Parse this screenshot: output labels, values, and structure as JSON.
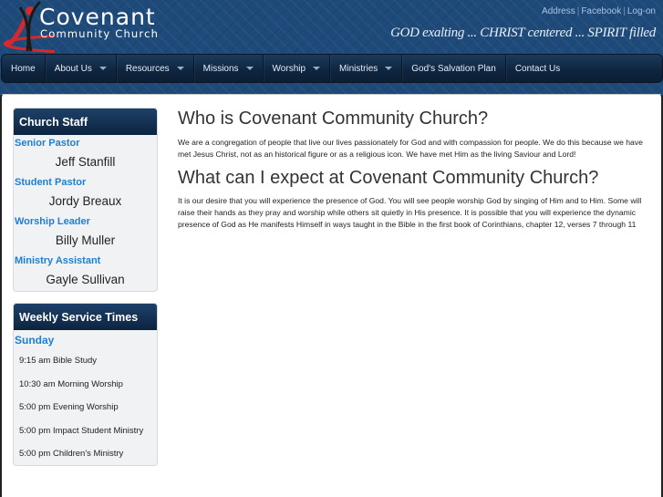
{
  "header": {
    "logo_title": "Covenant",
    "logo_subtitle": "Community Church",
    "logo_colors": {
      "accent_red": "#d42a2f",
      "dark": "#1a1a1a"
    },
    "top_links": [
      "Address",
      "Facebook",
      "Log-on"
    ],
    "tagline": "GOD exalting ... CHRIST centered ... SPIRIT filled"
  },
  "nav": {
    "items": [
      {
        "label": "Home",
        "dropdown": false
      },
      {
        "label": "About Us",
        "dropdown": true
      },
      {
        "label": "Resources",
        "dropdown": true
      },
      {
        "label": "Missions",
        "dropdown": true
      },
      {
        "label": "Worship",
        "dropdown": true
      },
      {
        "label": "Ministries",
        "dropdown": true
      },
      {
        "label": "God's Salvation Plan",
        "dropdown": false
      },
      {
        "label": "Contact Us",
        "dropdown": false
      }
    ]
  },
  "sidebar": {
    "staff": {
      "title": "Church Staff",
      "members": [
        {
          "role": "Senior Pastor",
          "name": "Jeff Stanfill"
        },
        {
          "role": "Student Pastor",
          "name": "Jordy Breaux"
        },
        {
          "role": "Worship Leader",
          "name": "Billy Muller"
        },
        {
          "role": "Ministry Assistant",
          "name": "Gayle Sullivan"
        }
      ]
    },
    "services": {
      "title": "Weekly Service Times",
      "day": "Sunday",
      "items": [
        "9:15 am Bible Study",
        "10:30 am Morning Worship",
        "5:00 pm Evening Worship",
        "5:00 pm Impact Student Ministry",
        "5:00 pm Children's Ministry"
      ]
    }
  },
  "main": {
    "heading1": "Who is Covenant Community Church?",
    "para1": "We are a congregation of people that live our lives passionately for God and with compassion for people. We do this because we have met Jesus Christ, not as an historical figure or as a religious icon. We have met Him as the living Saviour and Lord!",
    "heading2": "What can I expect at Covenant Community Church?",
    "para2": "It is our desire that you will experience the presence of God. You will see people worship God by singing of Him and to Him. Some will raise their hands as they pray and worship while others sit quietly in His presence. It is possible that you will experience the dynamic presence of God as He manifests Himself in ways taught in the Bible in the first book of Corinthians, chapter 12, verses 7 through 11"
  }
}
